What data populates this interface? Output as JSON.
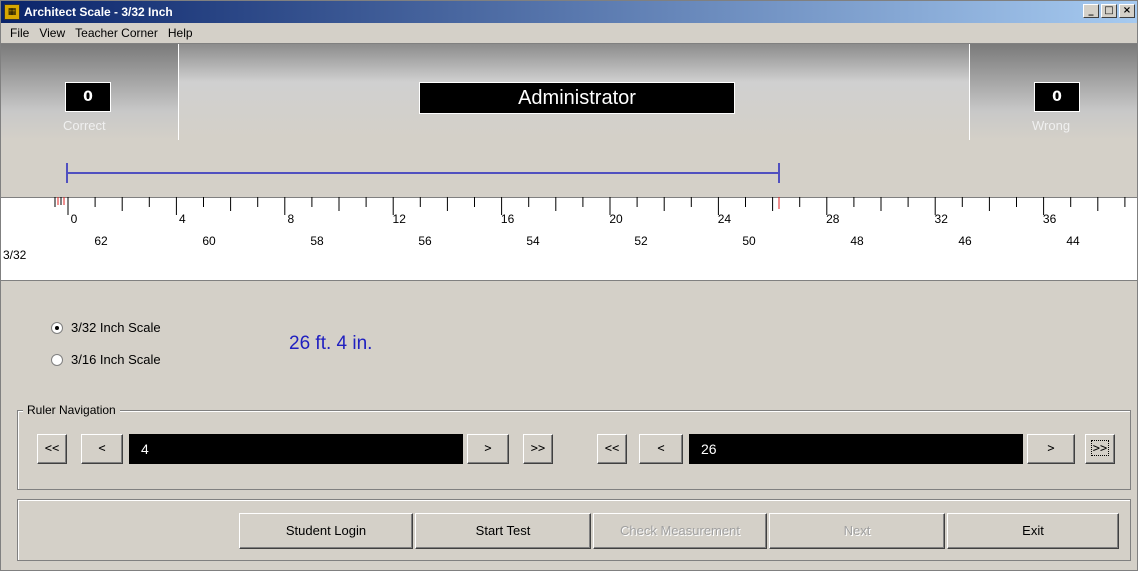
{
  "window": {
    "title": "Architect Scale - 3/32 Inch",
    "minimize": "_",
    "maximize": "□",
    "close": "×"
  },
  "menu": [
    "File",
    "View",
    "Teacher Corner",
    "Help"
  ],
  "score": {
    "correct_value": "0",
    "correct_label": "Correct",
    "wrong_value": "0",
    "wrong_label": "Wrong",
    "user": "Administrator"
  },
  "ruler": {
    "scale_label": "3/32",
    "top_numbers": [
      "0",
      "4",
      "8",
      "12",
      "16",
      "20",
      "24",
      "28",
      "32",
      "36"
    ],
    "bottom_numbers": [
      "62",
      "60",
      "58",
      "56",
      "54",
      "52",
      "50",
      "48",
      "46",
      "44"
    ]
  },
  "options": {
    "scale_3_32": "3/32  Inch Scale",
    "scale_3_16": "3/16  Inch Scale",
    "selected": "3/32"
  },
  "measurement_text": "26 ft. 4 in.",
  "navigation": {
    "legend": "Ruler Navigation",
    "left_value": "4",
    "right_value": "26",
    "first": "<<",
    "prev": "<",
    "next": ">",
    "last": ">>"
  },
  "buttons": {
    "student_login": "Student Login",
    "start_test": "Start Test",
    "check_measurement": "Check Measurement",
    "next": "Next",
    "exit": "Exit"
  },
  "colors": {
    "measure_line": "#5050c0",
    "marker": "#e02020",
    "measurement_text": "#2020c0"
  }
}
